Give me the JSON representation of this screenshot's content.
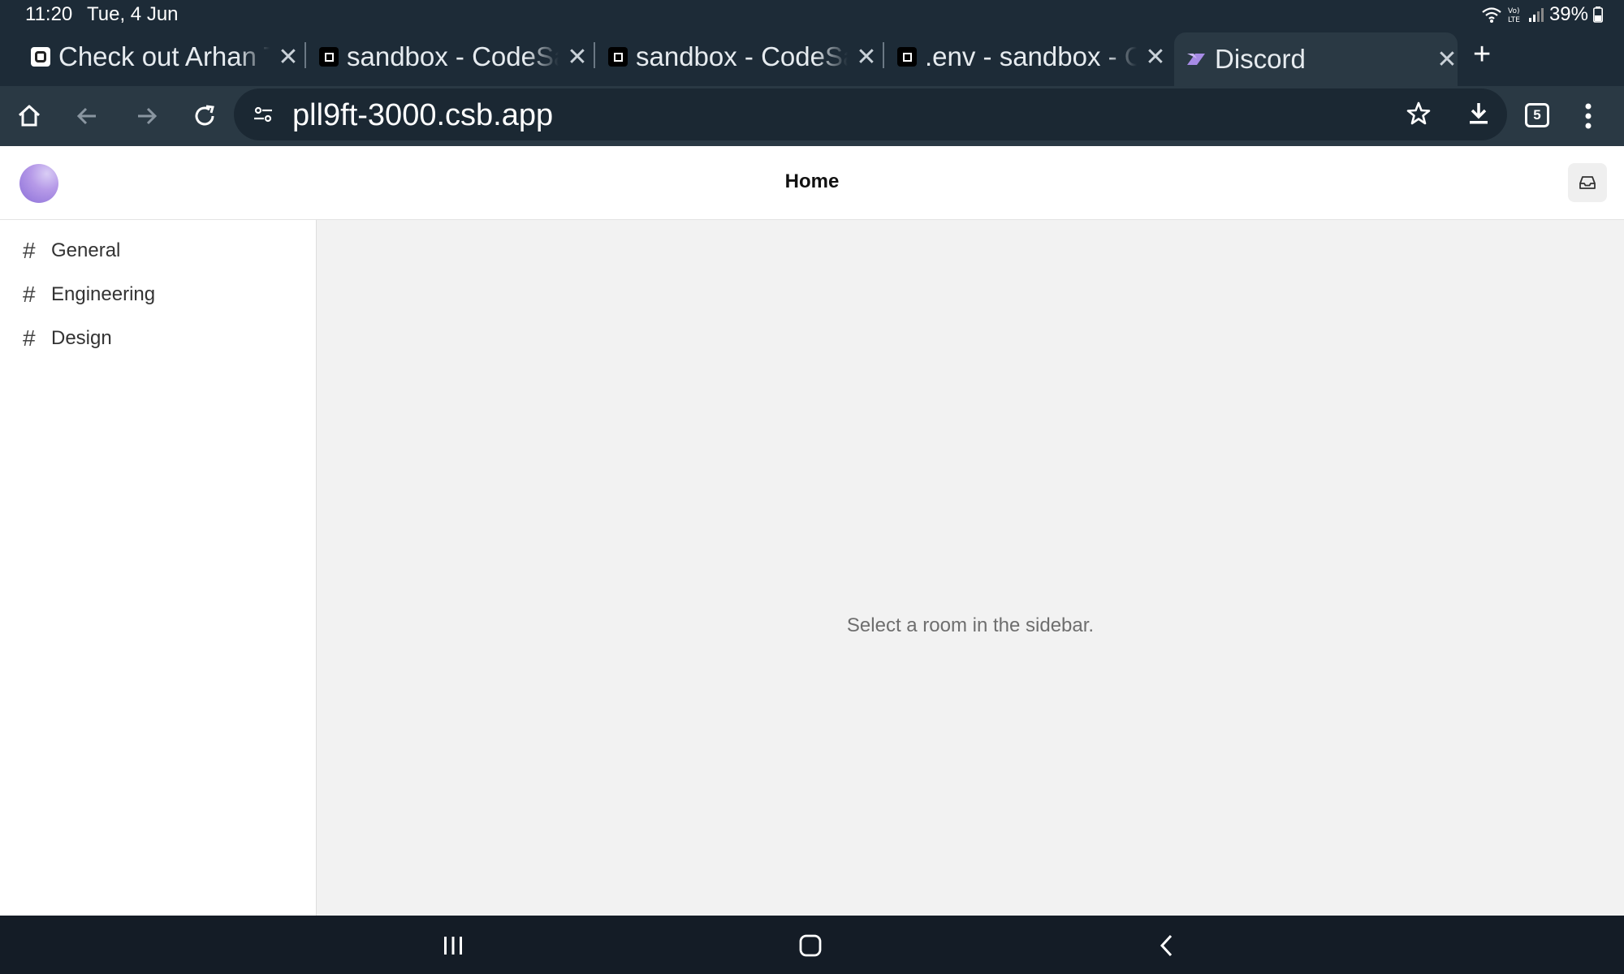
{
  "status_bar": {
    "time": "11:20",
    "date": "Tue, 4 Jun",
    "battery": "39%"
  },
  "tabs": [
    {
      "title": "Check out Arhan Ta",
      "favicon": "codesandbox-g-icon",
      "active": false
    },
    {
      "title": "sandbox - CodeSar",
      "favicon": "codesandbox-icon",
      "active": false
    },
    {
      "title": "sandbox - CodeSar",
      "favicon": "codesandbox-icon",
      "active": false
    },
    {
      "title": ".env - sandbox - Co",
      "favicon": "codesandbox-icon",
      "active": false
    },
    {
      "title": "Discord",
      "favicon": "discord-icon",
      "active": true
    }
  ],
  "toolbar": {
    "url": "pll9ft-3000.csb.app",
    "tab_count": "5"
  },
  "app": {
    "title": "Home",
    "rooms": [
      {
        "label": "General"
      },
      {
        "label": "Engineering"
      },
      {
        "label": "Design"
      }
    ],
    "empty_message": "Select a room in the sidebar."
  },
  "colors": {
    "chrome_bg": "#1d2b37",
    "toolbar_bg": "#2a3944",
    "avatar": "#a78be6",
    "nav_bg": "#141c26"
  }
}
